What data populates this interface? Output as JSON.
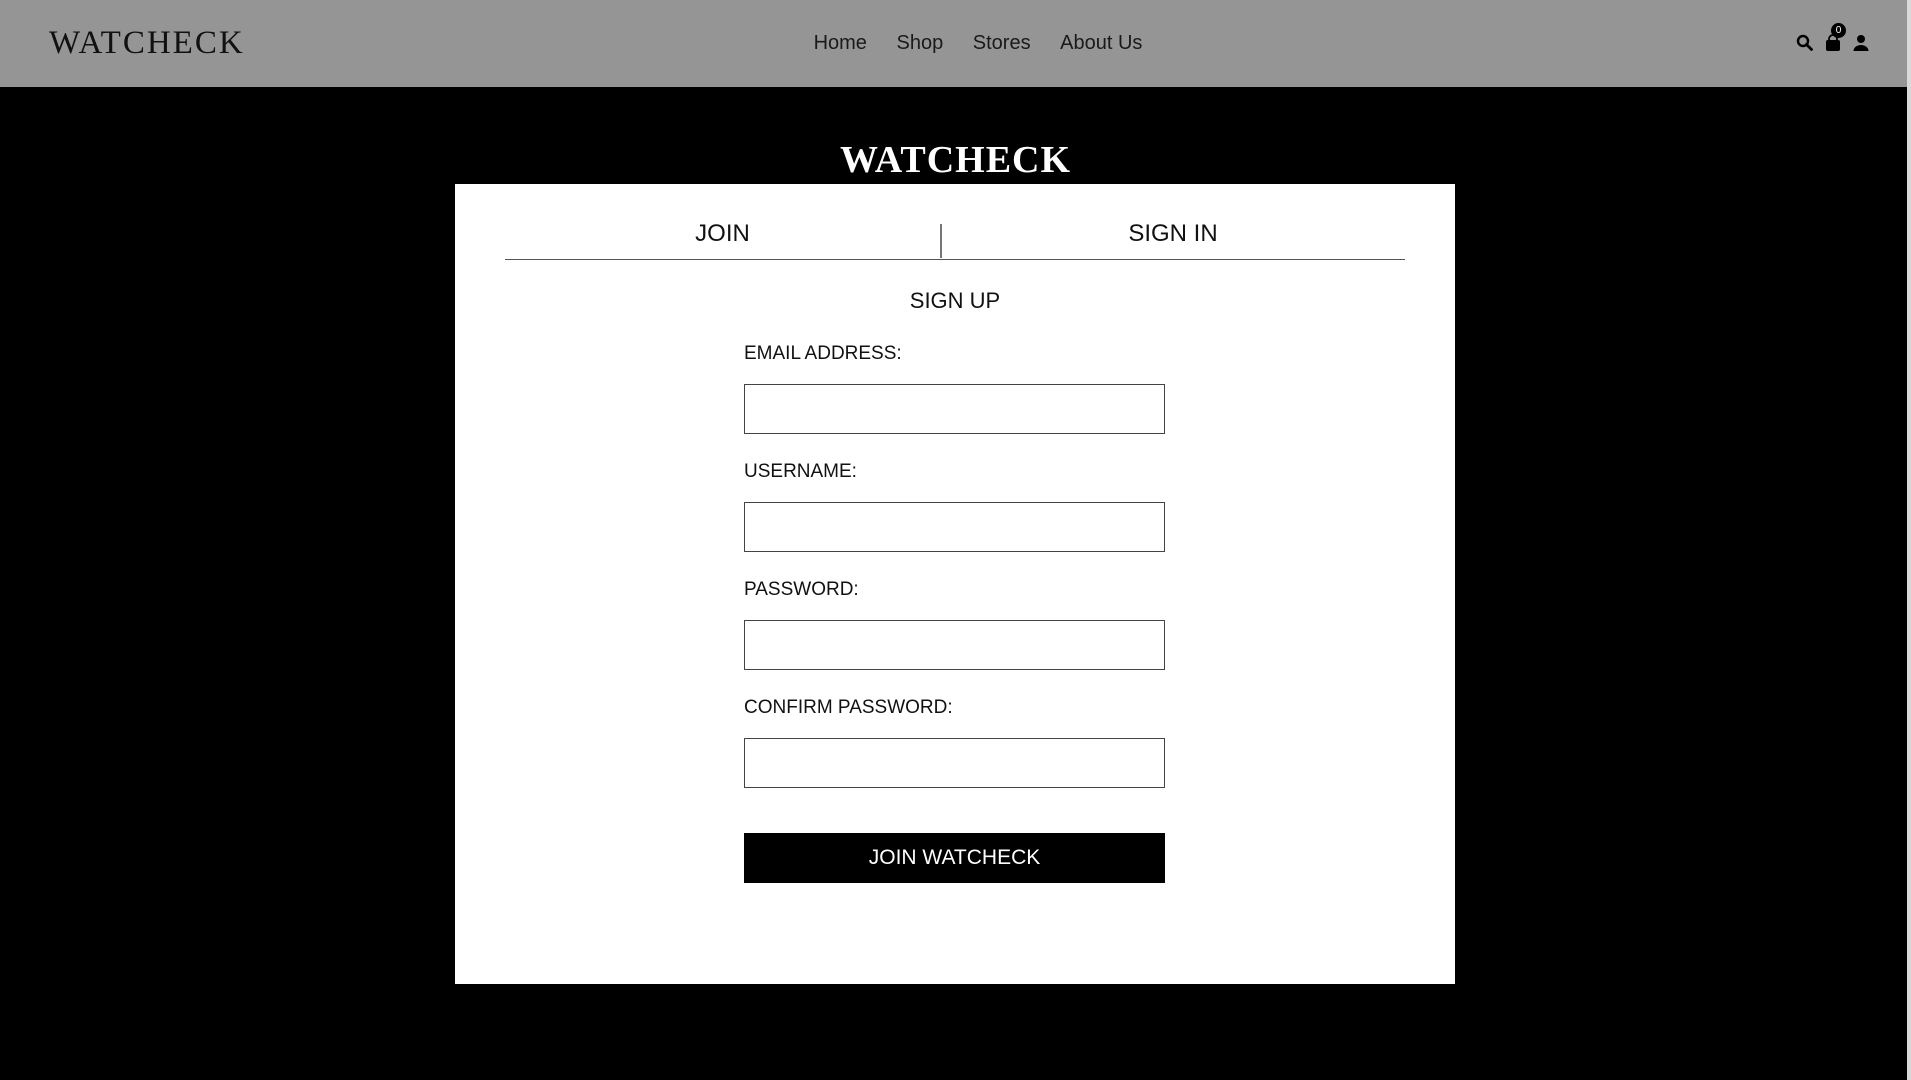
{
  "navbar": {
    "brand": "WATCHECK",
    "links": [
      "Home",
      "Shop",
      "Stores",
      "About Us"
    ],
    "icons": [
      "search-icon",
      "cart-icon",
      "user-icon"
    ],
    "cart_count": "0"
  },
  "hero": {
    "title": "WATCHECK"
  },
  "tabs": {
    "join": "JOIN",
    "sign_in": "SIGN IN"
  },
  "form": {
    "title": "SIGN UP",
    "fields": [
      {
        "label": "EMAIL ADDRESS:",
        "value": "",
        "placeholder": ""
      },
      {
        "label": "USERNAME:",
        "value": "",
        "placeholder": ""
      },
      {
        "label": "PASSWORD:",
        "value": "",
        "placeholder": ""
      },
      {
        "label": "CONFIRM PASSWORD:",
        "value": "",
        "placeholder": ""
      }
    ],
    "submit_label": "JOIN WATCHECK"
  },
  "colors": {
    "navbar_bg": "#959595",
    "page_bg": "#000000",
    "card_bg": "#ffffff",
    "button_bg": "#000000"
  }
}
